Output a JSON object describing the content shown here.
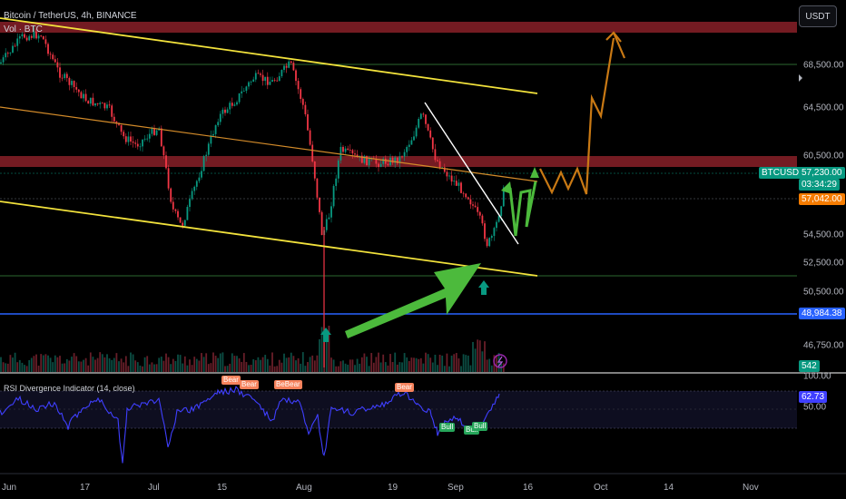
{
  "header": {
    "symbol_line": "Bitcoin / TetherUS, 4h, BINANCE",
    "volume_line": "Vol · BTC",
    "currency_button": "USDT"
  },
  "price_axis": {
    "ticks": [
      "68,500.00",
      "64,500.00",
      "60,500.00",
      "54,500.00",
      "52,500.00",
      "50,500.00",
      "46,750.00"
    ],
    "symbol_tag": "BTCUSDT",
    "last_price": "57,230.00",
    "countdown": "03:34:29",
    "open_price_tag": "57,042.00",
    "level_tag": "48,984.38",
    "volume_tag": "542"
  },
  "rsi_panel": {
    "title": "RSI Divergence Indicator (14, close)",
    "ticks": [
      "100.00",
      "50.00"
    ],
    "value_tag": "62.73",
    "bear_labels": [
      "Bear",
      "Bear",
      "BeBear",
      "Bear"
    ],
    "bull_labels": [
      "Bull",
      "Bull",
      "Bull"
    ]
  },
  "time_axis": {
    "ticks": [
      "Jun",
      "17",
      "Jul",
      "15",
      "Aug",
      "19",
      "Sep",
      "16",
      "Oct",
      "14",
      "Nov"
    ]
  },
  "colors": {
    "background": "#000000",
    "resistance_zone": "#7a1c24",
    "channel_yellow": "#f2e23c",
    "channel_orange": "#d38b2a",
    "support_blue": "#2962ff",
    "support_green": "#4caf50",
    "projection_orange": "#c97914",
    "projection_green": "#4cba3c",
    "up_arrow_teal": "#089981",
    "rsi_line": "#3f3fff",
    "bear_label": "#f7825c",
    "bull_label": "#26a65a",
    "last_price_tag": "#089981",
    "open_price_tag": "#f57c00",
    "level_tag": "#2962ff"
  }
}
